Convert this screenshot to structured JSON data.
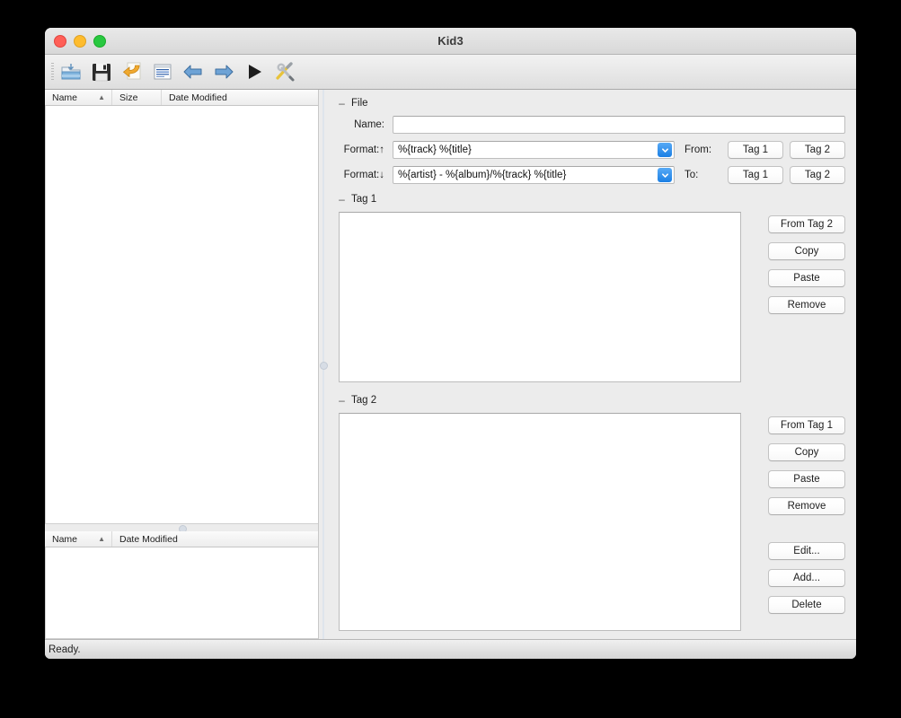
{
  "window": {
    "title": "Kid3",
    "traffic_lights": [
      {
        "name": "close",
        "color": "#ff5f57"
      },
      {
        "name": "minimize",
        "color": "#febc2e"
      },
      {
        "name": "zoom",
        "color": "#28c840"
      }
    ]
  },
  "toolbar": {
    "buttons": [
      {
        "icon": "open-folder-icon",
        "label": "Open"
      },
      {
        "icon": "save-icon",
        "label": "Save"
      },
      {
        "icon": "undo-icon",
        "label": "Revert"
      },
      {
        "icon": "document-preview-icon",
        "label": "Preview"
      },
      {
        "icon": "arrow-left-icon",
        "label": "Previous File"
      },
      {
        "icon": "arrow-right-icon",
        "label": "Next File"
      },
      {
        "icon": "play-icon",
        "label": "Play"
      },
      {
        "icon": "tools-icon",
        "label": "Settings"
      }
    ]
  },
  "file_list_top": {
    "columns": [
      "Name",
      "Size",
      "Date Modified"
    ],
    "sort_indicator": "▲",
    "rows": []
  },
  "file_list_bottom": {
    "columns": [
      "Name",
      "Date Modified"
    ],
    "sort_indicator": "▲",
    "rows": []
  },
  "file_section": {
    "title": "File",
    "collapse_indicator": "–",
    "name_label": "Name:",
    "name_value": "",
    "name_placeholder": "",
    "format_up_label": "Format:↑",
    "format_up_value": "%{track} %{title}",
    "format_down_label": "Format:↓",
    "format_down_value": "%{artist} - %{album}/%{track} %{title}",
    "from_label": "From:",
    "to_label": "To:",
    "from_tag1_label": "Tag 1",
    "from_tag2_label": "Tag 2",
    "to_tag1_label": "Tag 1",
    "to_tag2_label": "Tag 2"
  },
  "tag1_section": {
    "title": "Tag 1",
    "collapse_indicator": "–",
    "buttons": [
      "From Tag 2",
      "Copy",
      "Paste",
      "Remove"
    ],
    "rows": []
  },
  "tag2_section": {
    "title": "Tag 2",
    "collapse_indicator": "–",
    "buttons_primary": [
      "From Tag 1",
      "Copy",
      "Paste",
      "Remove"
    ],
    "buttons_secondary": [
      "Edit...",
      "Add...",
      "Delete"
    ],
    "rows": []
  },
  "status_bar": {
    "message": "Ready."
  },
  "colors": {
    "window_bg": "#ececec",
    "titlebar_bg": "#e0e0e0",
    "accent_blue": "#1b7fe4",
    "field_bg": "#ffffff",
    "desktop_bg": "#000000"
  }
}
